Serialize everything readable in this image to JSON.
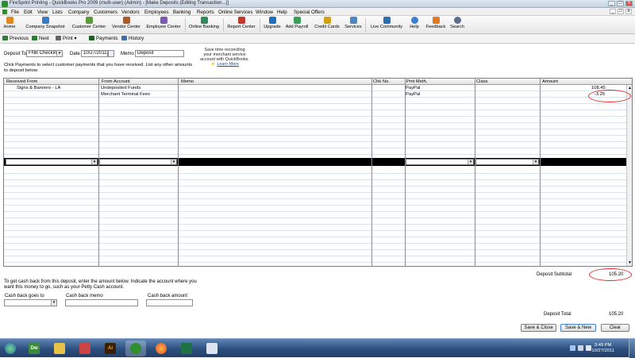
{
  "window": {
    "title": "FireSprint Printing - QuickBooks Pro 2009 (multi-user) (Admin) - [Make Deposits (Editing Transaction...)]",
    "controls": [
      "_",
      "□",
      "x"
    ]
  },
  "menu": {
    "items": [
      "File",
      "Edit",
      "View",
      "Lists",
      "Company",
      "Customers",
      "Vendors",
      "Employees",
      "Banking",
      "Reports",
      "Online Services",
      "Window",
      "Help",
      "Special Offers"
    ]
  },
  "iconbar": {
    "items": [
      "Home",
      "Company Snapshot",
      "Customer Center",
      "Vendor Center",
      "Employee Center",
      "Online Banking",
      "Report Center",
      "Upgrade",
      "Add Payroll",
      "Credit Cards",
      "Services",
      "Live Community",
      "Help",
      "Feedback",
      "Search"
    ]
  },
  "form_toolbar": {
    "previous": "Previous",
    "next": "Next",
    "print": "Print",
    "print_arrow": "▾",
    "payments": "Payments",
    "history": "History"
  },
  "header": {
    "deposit_to_label": "Deposit To",
    "deposit_to_value": "FNB Checking",
    "date_label": "Date",
    "date_value": "10/27/2011",
    "memo_label": "Memo",
    "memo_value": "Deposit",
    "instructions": "Click Payments to select customer payments that you have received. List any other amounts to deposit below."
  },
  "ad": {
    "text": "Save time reconciling your merchant service account with QuickBooks.",
    "link": "Learn More"
  },
  "grid": {
    "columns": [
      "Received From",
      "From Account",
      "Memo",
      "Chk No.",
      "Pmt Meth.",
      "Class",
      "Amount"
    ],
    "rows": [
      {
        "received_from": "Signs & Banners - LA",
        "from_account": "Undeposited Funds",
        "memo": "",
        "chk_no": "",
        "pmt_meth": "PayPal",
        "class": "",
        "amount": "108.45"
      },
      {
        "received_from": "",
        "from_account": "Merchant Terminal Fees",
        "memo": "",
        "chk_no": "",
        "pmt_meth": "PayPal",
        "class": "",
        "amount": "-3.25"
      }
    ],
    "dropdown_glyph": "▾"
  },
  "footer": {
    "cashback_instructions": "To get cash back from this deposit, enter the amount below. Indicate the account where you want this money to go, such as your Petty Cash account.",
    "cashback_goes_to_label": "Cash back goes to",
    "cashback_memo_label": "Cash back memo",
    "cashback_amount_label": "Cash back amount",
    "deposit_subtotal_label": "Deposit Subtotal",
    "deposit_subtotal_value": "105.20",
    "deposit_total_label": "Deposit Total",
    "deposit_total_value": "105.20",
    "save_close": "Save & Close",
    "save_new": "Save & New",
    "clear": "Clear"
  },
  "taskbar": {
    "apps": [
      "Start",
      "Dreamweaver",
      "Windows Explorer",
      "Network",
      "Illustrator",
      "QuickBooks",
      "Firefox",
      "Excel",
      "Notepad"
    ],
    "dw_label": "Dw",
    "ai_label": "Ai",
    "clock_time": "3:49 PM",
    "clock_date": "10/27/2011"
  },
  "colors": {
    "annotation_circle": "#e03030",
    "selected_row": "#000000",
    "grid_line": "#d7e3ef",
    "taskbar": "#2c4f7f"
  }
}
